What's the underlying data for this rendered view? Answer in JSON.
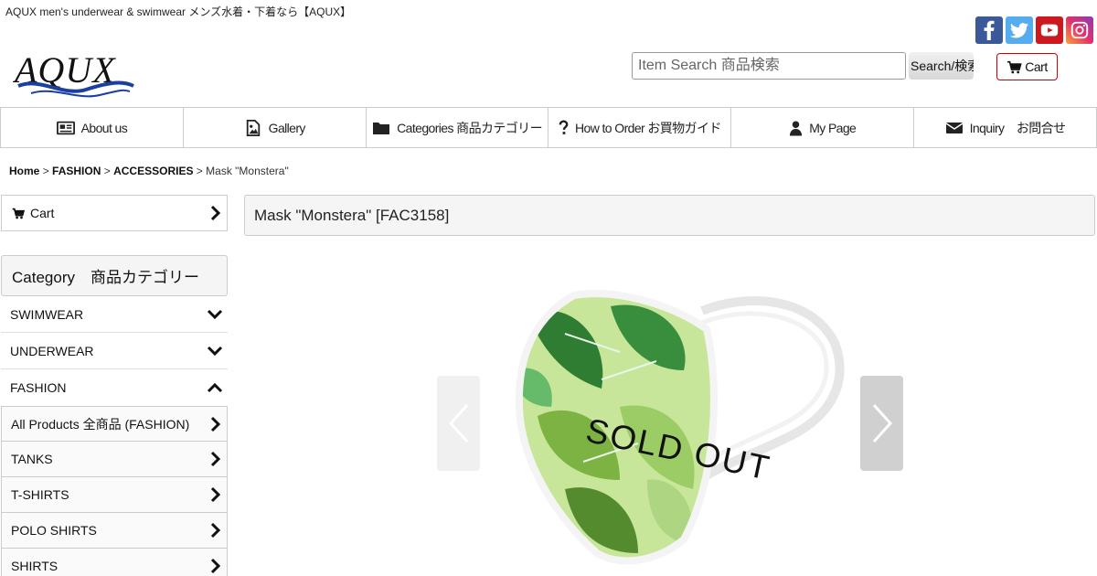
{
  "header": {
    "tagline": "AQUX men's underwear & swimwear メンズ水着・下着なら【AQUX】",
    "logo_text": "AQUX",
    "social": [
      {
        "icon": "facebook-icon",
        "color": "#3b5998"
      },
      {
        "icon": "twitter-icon",
        "color": "#55acee"
      },
      {
        "icon": "youtube-icon",
        "color": "#cc181e"
      },
      {
        "icon": "instagram-icon",
        "color": "#d6249f"
      }
    ],
    "search": {
      "placeholder": "Item Search 商品検索",
      "value": "",
      "button_label": "Search/検索"
    },
    "cart_label": "Cart"
  },
  "nav": [
    {
      "label": "About us",
      "icon": "newspaper-icon"
    },
    {
      "label": "Gallery",
      "icon": "image-icon"
    },
    {
      "label": "Categories 商品カテゴリー",
      "icon": "folder-icon"
    },
    {
      "label": "How to Order お買物ガイド",
      "icon": "question-icon"
    },
    {
      "label": "My Page",
      "icon": "user-icon"
    },
    {
      "label": "Inquiry　お問合せ",
      "icon": "envelope-icon"
    }
  ],
  "breadcrumb": {
    "items": [
      "Home",
      "FASHION",
      "ACCESSORIES"
    ],
    "separator": ">",
    "current": "Mask \"Monstera\""
  },
  "sidebar": {
    "cart_label": "Cart",
    "category_heading": "Category　商品カテゴリー",
    "categories": [
      {
        "label": "SWIMWEAR",
        "state": "collapsed"
      },
      {
        "label": "UNDERWEAR",
        "state": "collapsed"
      },
      {
        "label": "FASHION",
        "state": "expanded"
      }
    ],
    "fashion_sub": [
      "All Products 全商品 (FASHION)",
      "TANKS",
      "T-SHIRTS",
      "POLO SHIRTS",
      "SHIRTS"
    ]
  },
  "product": {
    "title": "Mask \"Monstera\" [FAC3158]",
    "overlay_text": "SOLD OUT"
  },
  "colors": {
    "accent_border": "#cc0000",
    "logo_blue": "#1a3fa0",
    "panel_bg": "#f5f5f5"
  }
}
